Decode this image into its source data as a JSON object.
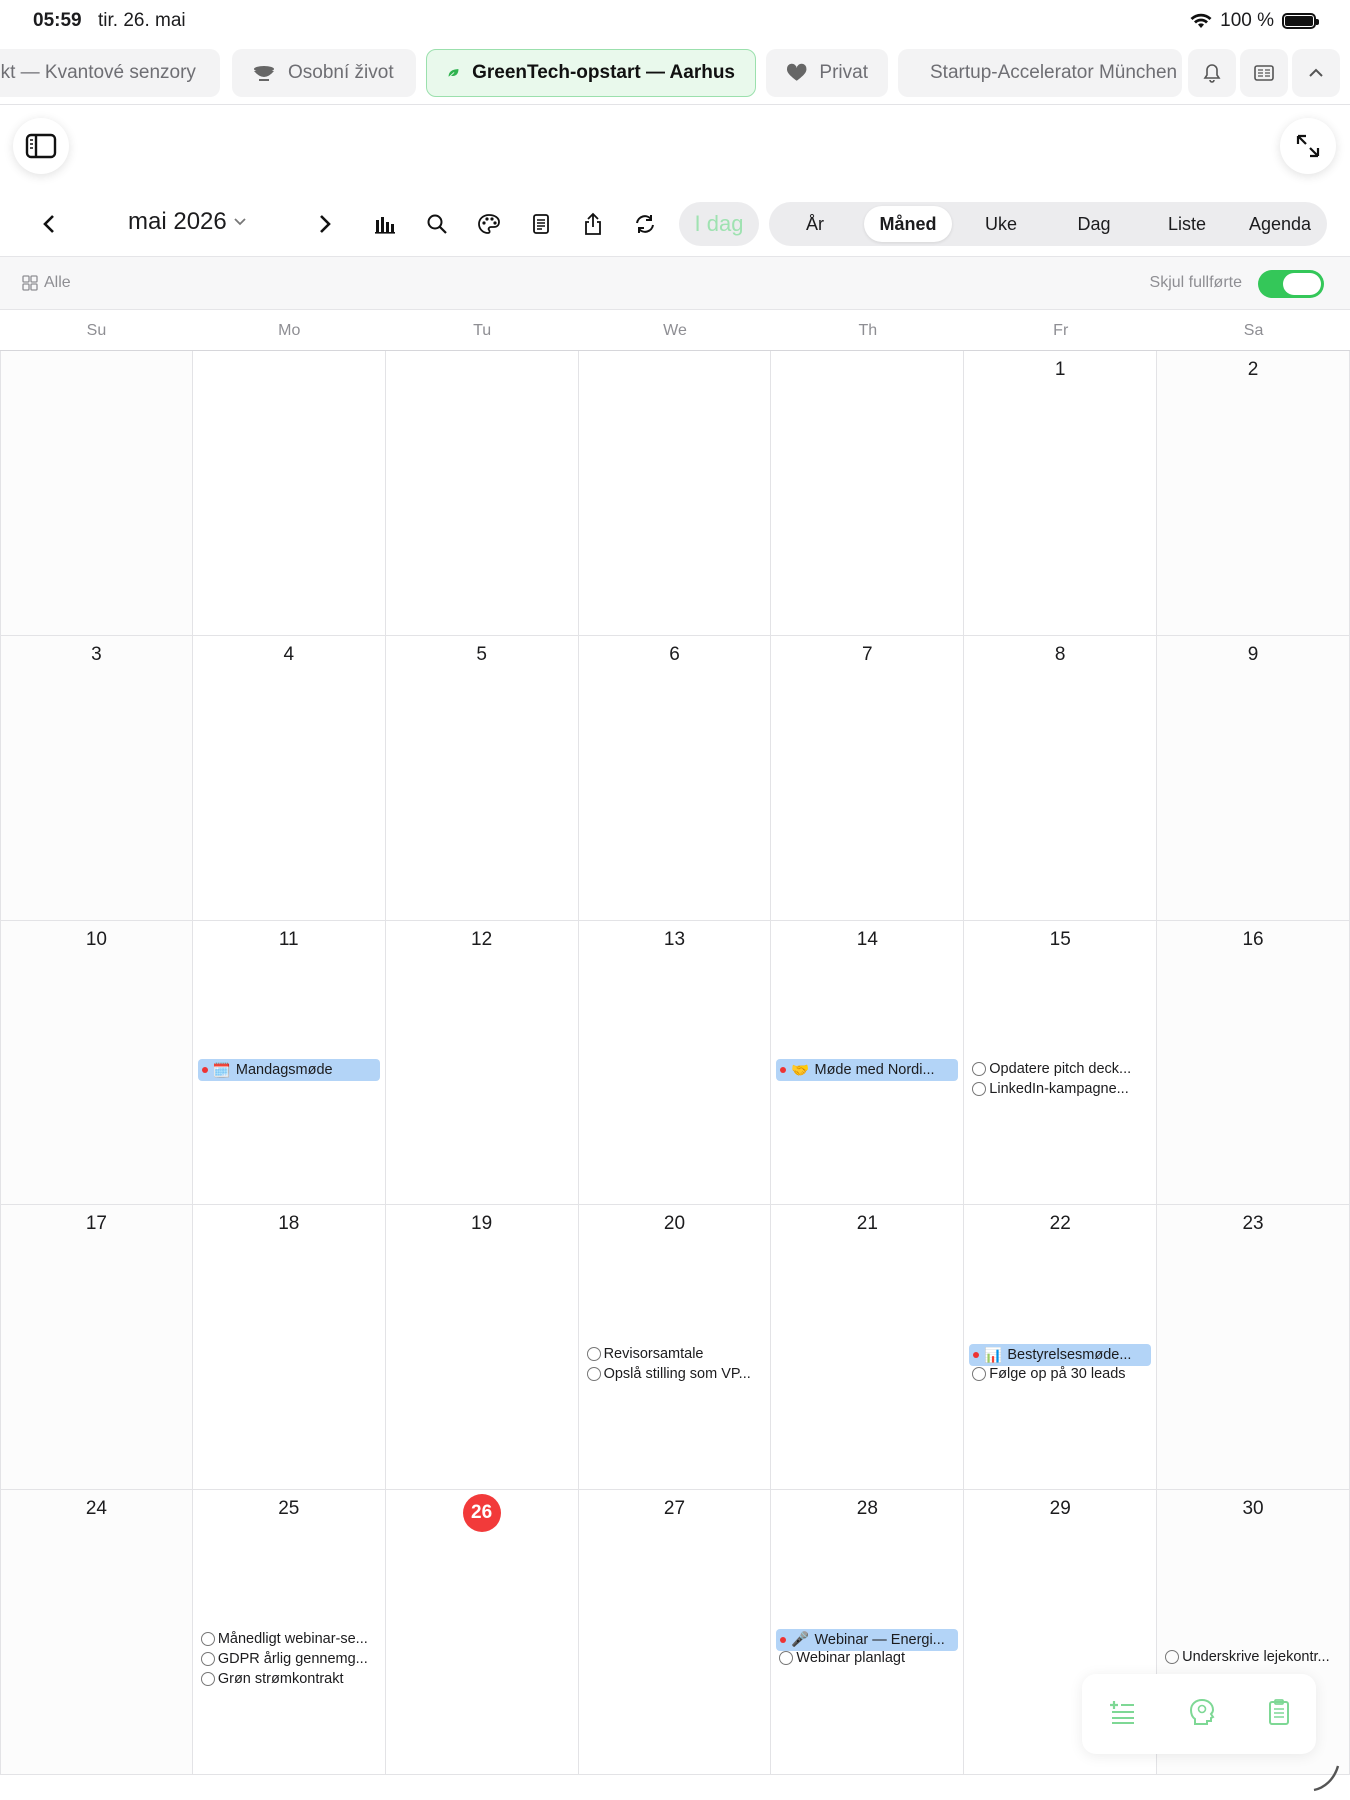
{
  "status_bar": {
    "time": "05:59",
    "date": "tir. 26. mai",
    "battery": "100 %"
  },
  "tabs": [
    {
      "label": "ekt — Kvantové senzory",
      "icon": "none"
    },
    {
      "label": "Osobní život",
      "icon": "bowl-icon"
    },
    {
      "label": "GreenTech-opstart — Aarhus",
      "icon": "leaf-icon",
      "active": true
    },
    {
      "label": "Privat",
      "icon": "heart-icon"
    },
    {
      "label": "Startup-Accelerator München",
      "icon": "lightbulb-icon"
    }
  ],
  "toolbar": {
    "month_title": "mai 2026",
    "today_label": "I dag",
    "views": [
      "År",
      "Måned",
      "Uke",
      "Dag",
      "Liste",
      "Agenda"
    ],
    "selected_view": "Måned"
  },
  "filter": {
    "all_label": "Alle",
    "hide_completed_label": "Skjul fullførte",
    "hide_completed": true
  },
  "weekdays": [
    "Su",
    "Mo",
    "Tu",
    "We",
    "Th",
    "Fr",
    "Sa"
  ],
  "today": 26,
  "calendar": {
    "month": "mai 2026",
    "leading_blank_days": 5,
    "days_in_month": 31,
    "entries": [
      {
        "day": 11,
        "kind": "event",
        "emoji": "🗓️",
        "title": "Mandagsmøde"
      },
      {
        "day": 14,
        "kind": "event",
        "emoji": "🤝",
        "title": "Møde med Nordi..."
      },
      {
        "day": 15,
        "kind": "task",
        "title": "Opdatere pitch deck..."
      },
      {
        "day": 15,
        "kind": "task",
        "title": "LinkedIn-kampagne..."
      },
      {
        "day": 20,
        "kind": "task",
        "title": "Revisorsamtale"
      },
      {
        "day": 20,
        "kind": "task",
        "title": "Opslå stilling som VP..."
      },
      {
        "day": 22,
        "kind": "event",
        "emoji": "📊",
        "title": "Bestyrelsesmøde..."
      },
      {
        "day": 22,
        "kind": "task",
        "title": "Følge op på 30 leads"
      },
      {
        "day": 25,
        "kind": "task",
        "title": "Månedligt webinar-se..."
      },
      {
        "day": 25,
        "kind": "task",
        "title": "GDPR årlig gennemg..."
      },
      {
        "day": 25,
        "kind": "task",
        "title": "Grøn strømkontrakt"
      },
      {
        "day": 28,
        "kind": "event",
        "emoji": "🎤",
        "title": "Webinar — Energi..."
      },
      {
        "day": 28,
        "kind": "task",
        "title": "Webinar planlagt"
      },
      {
        "day": 30,
        "kind": "task",
        "title": "Underskrive lejekontr..."
      }
    ]
  },
  "colors": {
    "accent_green": "#34c759",
    "today_red": "#f23a3a",
    "event_blue": "#b3d4f7"
  }
}
